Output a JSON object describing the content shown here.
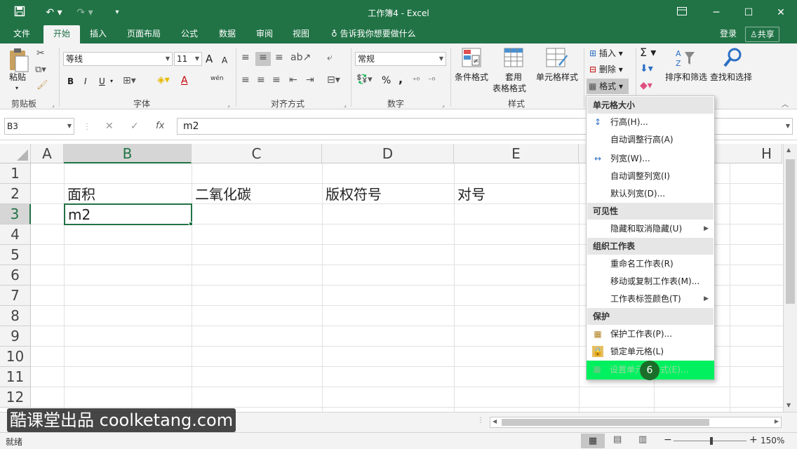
{
  "window": {
    "title": "工作簿4 - Excel"
  },
  "qat": {
    "save_icon": "save-icon",
    "undo_icon": "undo-icon",
    "redo_icon": "redo-icon",
    "customize_icon": "customize-qat-icon"
  },
  "window_controls": {
    "ribbon_options": "ribbon-display-icon",
    "minimize": "minimize-icon",
    "maximize": "maximize-icon",
    "close": "close-icon"
  },
  "menu": {
    "tabs": [
      "文件",
      "开始",
      "插入",
      "页面布局",
      "公式",
      "数据",
      "审阅",
      "视图"
    ],
    "active": "开始",
    "tell_me": "告诉我你想要做什么",
    "login": "登录",
    "share": "共享"
  },
  "ribbon": {
    "clipboard": {
      "paste": "粘贴",
      "label": "剪贴板"
    },
    "font": {
      "name": "等线",
      "size": "11",
      "bold": "B",
      "italic": "I",
      "underline": "U",
      "grow": "A",
      "shrink": "A",
      "label": "字体",
      "phonetic": "wén",
      "font_color": "A"
    },
    "alignment": {
      "label": "对齐方式"
    },
    "number": {
      "format": "常规",
      "percent": "%",
      "comma": ",",
      "label": "数字"
    },
    "styles": {
      "conditional": "条件格式",
      "table_l1": "套用",
      "table_l2": "表格格式",
      "cell_styles": "单元格样式",
      "label": "样式"
    },
    "cells": {
      "insert": "插入",
      "delete": "删除",
      "format": "格式"
    },
    "editing": {
      "sort_filter": "排序和筛选",
      "find_select": "查找和选择"
    }
  },
  "formula_bar": {
    "name_box": "B3",
    "cancel": "✕",
    "enter": "✓",
    "fx": "fx",
    "content": "m2"
  },
  "columns": [
    "A",
    "B",
    "C",
    "D",
    "E",
    "H"
  ],
  "rows": [
    "1",
    "2",
    "3",
    "4",
    "5",
    "6",
    "7",
    "8",
    "9",
    "10",
    "11",
    "12"
  ],
  "cells": {
    "B2": "面积",
    "C2": "二氧化碳",
    "D2": "版权符号",
    "E2": "对号",
    "B3": "m2"
  },
  "format_menu": {
    "sections": [
      {
        "title": "单元格大小",
        "items": [
          {
            "label": "行高(H)...",
            "icon": "row-height-icon"
          },
          {
            "label": "自动调整行高(A)"
          },
          {
            "label": "列宽(W)...",
            "icon": "column-width-icon"
          },
          {
            "label": "自动调整列宽(I)"
          },
          {
            "label": "默认列宽(D)..."
          }
        ]
      },
      {
        "title": "可见性",
        "items": [
          {
            "label": "隐藏和取消隐藏(U)",
            "submenu": true
          }
        ]
      },
      {
        "title": "组织工作表",
        "items": [
          {
            "label": "重命名工作表(R)"
          },
          {
            "label": "移动或复制工作表(M)..."
          },
          {
            "label": "工作表标签颜色(T)",
            "submenu": true
          }
        ]
      },
      {
        "title": "保护",
        "items": [
          {
            "label": "保护工作表(P)...",
            "icon": "protect-sheet-icon"
          },
          {
            "label": "锁定单元格(L)",
            "icon": "lock-icon"
          },
          {
            "label": "设置单元格格式(E)...",
            "icon": "format-cells-icon"
          }
        ]
      }
    ],
    "step_badge": "6",
    "highlight_color": "#00f060"
  },
  "status": {
    "ready": "就绪",
    "zoom": "150%",
    "zoom_minus": "−",
    "zoom_plus": "+"
  },
  "watermark": "酷课堂出品 coolketang.com",
  "colors": {
    "brand": "#217346",
    "selected_header": "#d6d6d6"
  }
}
